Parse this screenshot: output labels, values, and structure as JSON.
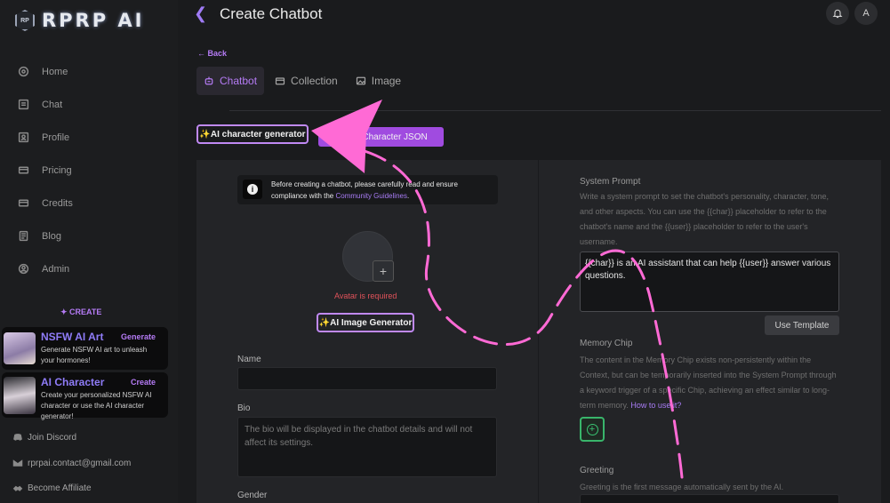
{
  "brand": {
    "logo_text": "RPRP AI",
    "logo_mark": "RP"
  },
  "sidebar": {
    "items": [
      {
        "label": "Home",
        "icon": "home-icon"
      },
      {
        "label": "Chat",
        "icon": "chat-icon"
      },
      {
        "label": "Profile",
        "icon": "profile-icon"
      },
      {
        "label": "Pricing",
        "icon": "pricing-icon"
      },
      {
        "label": "Credits",
        "icon": "credits-icon"
      },
      {
        "label": "Blog",
        "icon": "blog-icon"
      },
      {
        "label": "Admin",
        "icon": "admin-icon"
      }
    ],
    "create_label": "✦ CREATE",
    "promos": [
      {
        "title": "NSFW AI Art",
        "action": "Generate",
        "desc": "Generate NSFW AI art to unleash your hormones!"
      },
      {
        "title": "AI Character",
        "action": "Create",
        "desc": "Create your personalized NSFW AI character or use the AI character generator!"
      }
    ],
    "footer": [
      {
        "label": "Join Discord",
        "icon": "discord-icon"
      },
      {
        "label": "rprpai.contact@gmail.com",
        "icon": "mail-icon"
      },
      {
        "label": "Become Affiliate",
        "icon": "handshake-icon"
      }
    ]
  },
  "header": {
    "title": "Create Chatbot",
    "avatar_initial": "A"
  },
  "back_link": "← Back",
  "tabs": [
    {
      "label": "Chatbot",
      "icon": "robot-icon"
    },
    {
      "label": "Collection",
      "icon": "folder-icon"
    },
    {
      "label": "Image",
      "icon": "image-icon"
    }
  ],
  "actions": {
    "ai_generator": "✨AI character generator",
    "import_json": "Import Character JSON"
  },
  "notice": {
    "text": "Before creating a chatbot, please carefully read and ensure compliance with the ",
    "link": "Community Guidelines",
    "suffix": "."
  },
  "avatar": {
    "error": "Avatar is required",
    "add": "+"
  },
  "image_generator": "✨AI Image Generator",
  "form": {
    "name_label": "Name",
    "bio_label": "Bio",
    "bio_placeholder": "The bio will be displayed in the chatbot details and will not affect its settings.",
    "gender_label": "Gender"
  },
  "system_prompt": {
    "label": "System Prompt",
    "help": "Write a system prompt to set the chatbot's personality, character, tone, and other aspects. You can use the {{char}} placeholder to refer to the chatbot's name and the {{user}} placeholder to refer to the user's username.",
    "value": "{{char}} is an AI assistant that can help {{user}} answer various questions.",
    "template_button": "Use Template"
  },
  "memory_chip": {
    "label": "Memory Chip",
    "help": "The content in the Memory Chip exists non-persistently within the Context, but can be temporarily inserted into the System Prompt through a keyword trigger of a specific Chip, achieving an effect similar to long-term memory.",
    "link": "How to use it?"
  },
  "greeting": {
    "label": "Greeting",
    "help": "Greeting is the first message automatically sent by the AI."
  },
  "colors": {
    "accent": "#b57bf5",
    "annotation": "#ff6ad5",
    "success": "#3ac472",
    "error": "#e0525a"
  }
}
